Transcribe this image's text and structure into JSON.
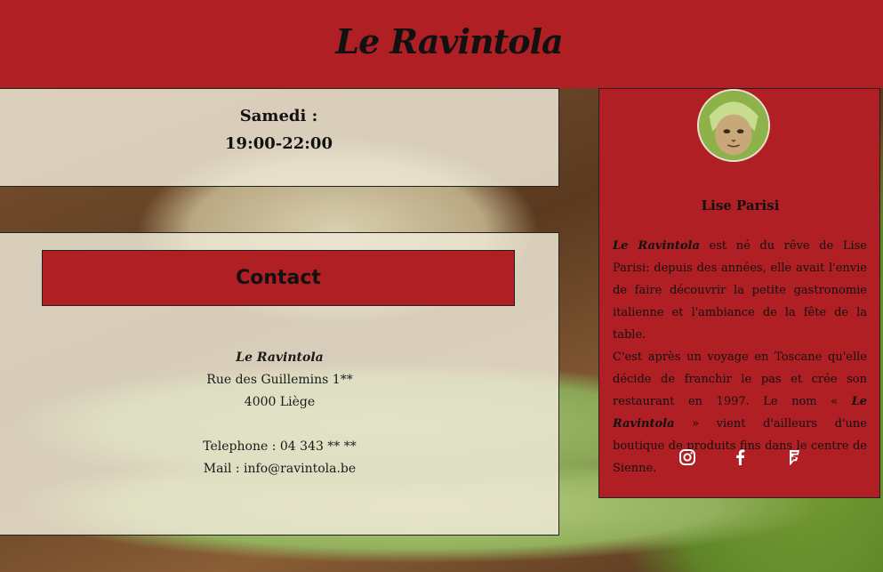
{
  "header": {
    "title": "Le Ravintola",
    "background": "#b01f23"
  },
  "hours": {
    "day": "Samedi :",
    "time": "19:00-22:00"
  },
  "contact": {
    "heading": "Contact",
    "name": "Le Ravintola",
    "street": "Rue des Guillemins 1**",
    "city": "4000 Liège",
    "phone": "Telephone : 04 343 ** **",
    "mail": "Mail : info@ravintola.be"
  },
  "profile": {
    "name": "Lise Parisi",
    "bio": {
      "brand1": "Le Ravintola",
      "text1": " est né du rêve de Lise Parisi: depuis des années, elle avait l'envie de faire découvrir la petite gastronomie italienne et l'ambiance de la fête de la table.",
      "text2": "C'est après un voyage en Toscane qu'elle décide de franchir le pas et crée son restaurant en 1997. Le nom « ",
      "brand2": "Le Ravintola",
      "text3": " » vient d'ailleurs d'une boutique de produits fins dans le centre de Sienne."
    },
    "socials": [
      "instagram-icon",
      "facebook-icon",
      "foursquare-icon"
    ]
  }
}
